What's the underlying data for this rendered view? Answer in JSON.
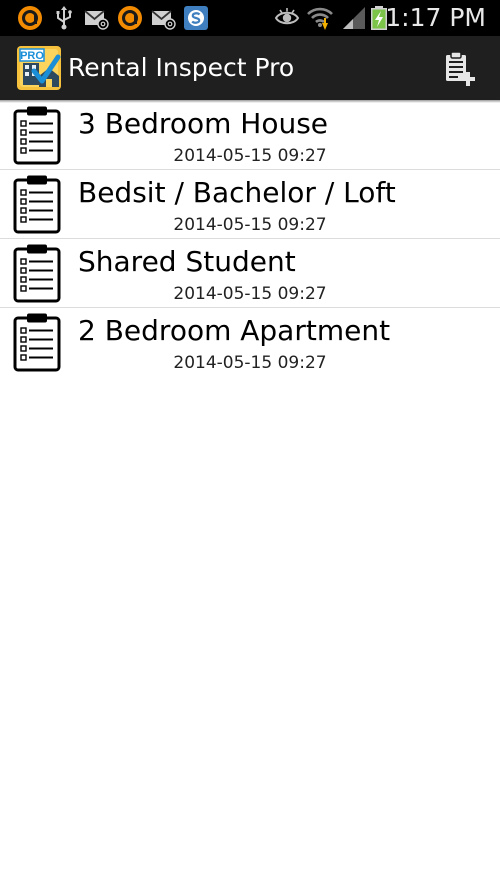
{
  "status_bar": {
    "time": "1:17 PM",
    "left_icons": [
      "orange-circle-icon",
      "usb-icon",
      "email-icon",
      "orange-circle-icon",
      "email-icon",
      "s-app-icon"
    ],
    "right_icons": [
      "eye-icon",
      "wifi-icon",
      "signal-icon",
      "battery-charging-icon"
    ]
  },
  "action_bar": {
    "title": "Rental Inspect Pro",
    "logo_text": "PRO",
    "add_action": "new-clipboard-icon",
    "background": "#1f1f1f"
  },
  "inspections": [
    {
      "title": "3 Bedroom House",
      "date": "2014-05-15 09:27"
    },
    {
      "title": "Bedsit / Bachelor / Loft",
      "date": "2014-05-15 09:27"
    },
    {
      "title": "Shared Student",
      "date": "2014-05-15 09:27"
    },
    {
      "title": "2 Bedroom Apartment",
      "date": "2014-05-15 09:27"
    }
  ],
  "colors": {
    "status_bar": "#000000",
    "notification_orange": "#f28b00",
    "battery_green": "#7cc34a",
    "logo_blue": "#1a8fd8",
    "list_divider": "#dcdcdc"
  }
}
